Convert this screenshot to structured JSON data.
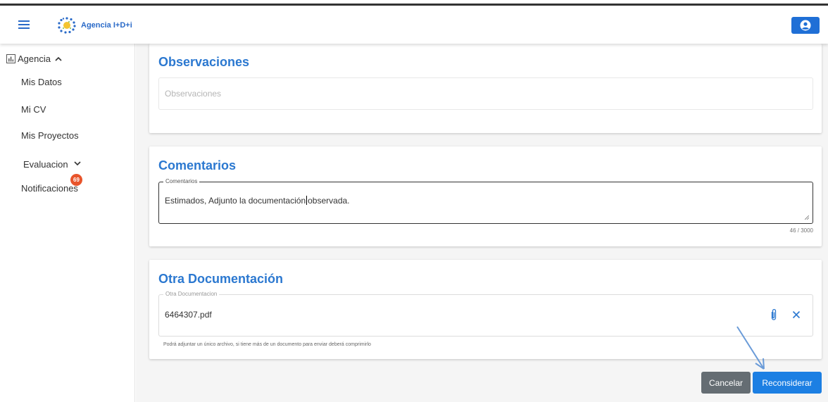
{
  "header": {
    "brand": "Agencia I+D+i",
    "menu_icon": "hamburger-icon",
    "user_icon": "user-circle-icon",
    "accent": "#1f6fd6"
  },
  "sidebar": {
    "section_label": "Agencia",
    "section_icon": "bar-chart-icon",
    "items": [
      {
        "label": "Mis Datos"
      },
      {
        "label": "Mi CV"
      },
      {
        "label": "Mis Proyectos"
      },
      {
        "label": "Evaluacion"
      },
      {
        "label": "Notificaciones"
      }
    ],
    "notification_count": "69",
    "badge_color": "#e8542b"
  },
  "observaciones": {
    "title": "Observaciones",
    "placeholder": "Observaciones"
  },
  "comentarios": {
    "title": "Comentarios",
    "field_label": "Comentarios",
    "text_before_caret": "Estimados, Adjunto la documentación",
    "text_after_caret": "observada.",
    "counter": "46 / 3000"
  },
  "otra_documentacion": {
    "title": "Otra Documentación",
    "field_label": "Otra Documentacion",
    "file_name": "6464307.pdf",
    "hint": "Podrá adjuntar un único archivo, si tiene más de un documento para enviar deberá comprimirlo"
  },
  "actions": {
    "cancel_label": "Cancelar",
    "reconsider_label": "Reconsiderar"
  }
}
